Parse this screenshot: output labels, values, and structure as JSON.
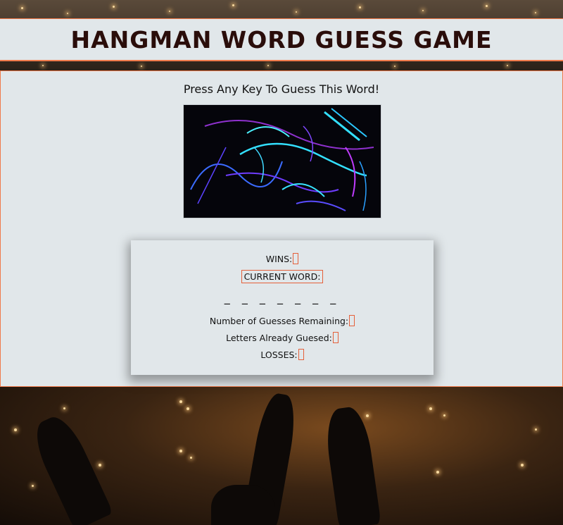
{
  "header": {
    "title": "HANGMAN WORD GUESS GAME"
  },
  "main": {
    "prompt": "Press Any Key To Guess This Word!",
    "image_icon": "neon-light-streaks-image"
  },
  "scoreboard": {
    "wins_label": "WINS:",
    "current_word_label": "CURRENT WORD:",
    "word_blanks": "_ _ _ _ _ _ _",
    "guesses_remaining_label": "Number of Guesses Remaining:",
    "letters_guessed_label": "Letters Already Guesed:",
    "losses_label": "LOSSES:"
  },
  "colors": {
    "accent": "#e5603a",
    "panel": "#e1e7ea",
    "title": "#2a0d0a"
  }
}
